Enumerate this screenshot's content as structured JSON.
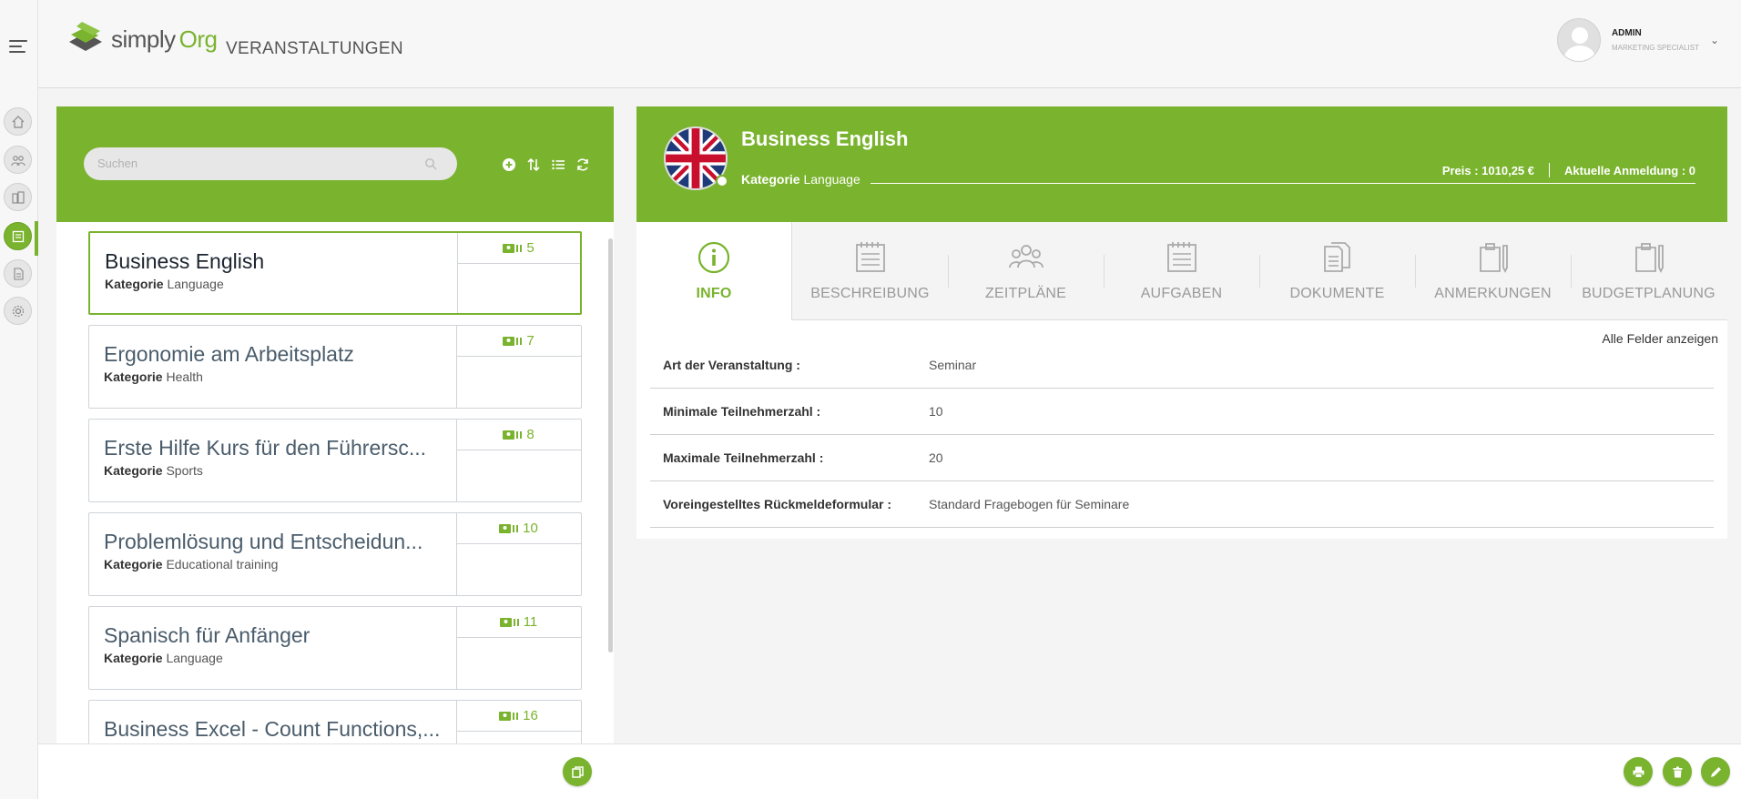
{
  "app": {
    "logo_text_1": "simply",
    "logo_text_2": "Org",
    "page_title": "VERANSTALTUNGEN"
  },
  "user": {
    "name": "ADMIN",
    "role": "MARKETING SPECIALIST"
  },
  "rail": {
    "items": [
      "home-icon",
      "people-icon",
      "buildings-icon",
      "events-icon",
      "document-icon",
      "settings-icon"
    ],
    "active_index": 3
  },
  "search": {
    "placeholder": "Suchen"
  },
  "list": {
    "category_label": "Kategorie",
    "items": [
      {
        "title": "Business English",
        "category": "Language",
        "count": "5"
      },
      {
        "title": "Ergonomie am Arbeitsplatz",
        "category": "Health",
        "count": "7"
      },
      {
        "title": "Erste Hilfe Kurs für den Führersc...",
        "category": "Sports",
        "count": "8"
      },
      {
        "title": "Problemlösung und Entscheidun...",
        "category": "Educational training",
        "count": "10"
      },
      {
        "title": "Spanisch für Anfänger",
        "category": "Language",
        "count": "11"
      },
      {
        "title": "Business Excel - Count Functions,...",
        "category": "",
        "count": "16"
      }
    ]
  },
  "detail": {
    "title": "Business English",
    "category_label": "Kategorie",
    "category": "Language",
    "price": "Preis : 1010,25 €",
    "registration": "Aktuelle Anmeldung : 0",
    "tabs": [
      "INFO",
      "BESCHREIBUNG",
      "ZEITPLÄNE",
      "AUFGABEN",
      "DOKUMENTE",
      "ANMERKUNGEN",
      "BUDGETPLANUNG"
    ],
    "active_tab": "INFO",
    "show_all": "Alle Felder anzeigen",
    "fields": [
      {
        "label": "Art der Veranstaltung :",
        "value": "Seminar"
      },
      {
        "label": "Minimale Teilnehmerzahl :",
        "value": "10"
      },
      {
        "label": "Maximale Teilnehmerzahl :",
        "value": "20"
      },
      {
        "label": "Voreingestelltes Rückmeldeformular :",
        "value": "Standard Fragebogen für Seminare"
      }
    ]
  },
  "colors": {
    "brand_green": "#7ab32e"
  }
}
